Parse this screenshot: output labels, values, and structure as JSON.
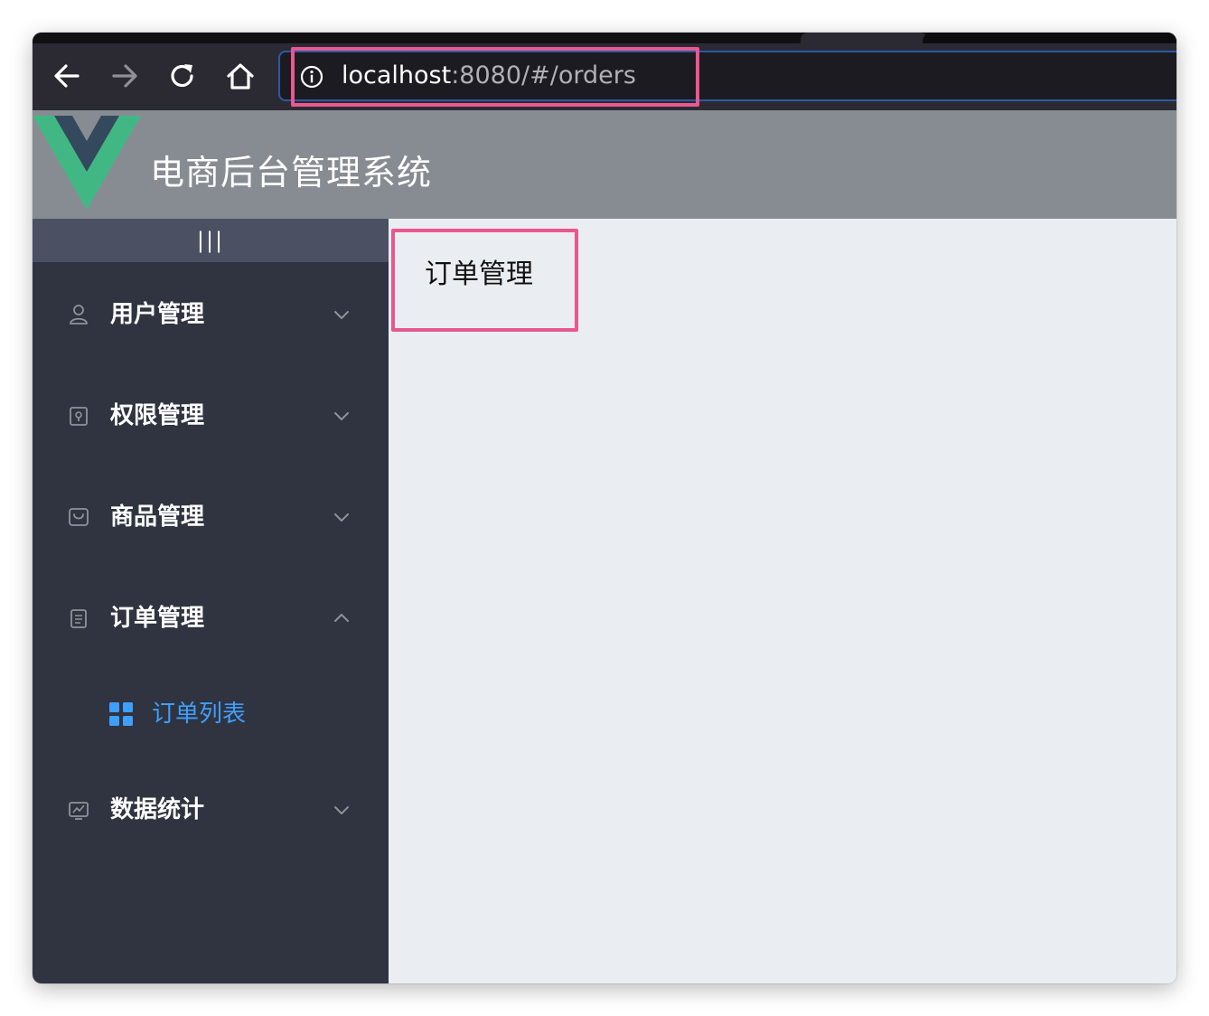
{
  "browser": {
    "url_host": "localhost",
    "url_rest": ":8080/#/orders"
  },
  "app": {
    "title": "电商后台管理系统"
  },
  "sidebar": {
    "collapse_label": "|||",
    "items": [
      {
        "label": "用户管理",
        "icon": "user-icon",
        "expanded": false
      },
      {
        "label": "权限管理",
        "icon": "lock-icon",
        "expanded": false
      },
      {
        "label": "商品管理",
        "icon": "goods-icon",
        "expanded": false
      },
      {
        "label": "订单管理",
        "icon": "order-icon",
        "expanded": true
      },
      {
        "label": "数据统计",
        "icon": "chart-icon",
        "expanded": false
      }
    ],
    "sub_items": [
      {
        "label": "订单列表",
        "icon": "menu-grid-icon",
        "active": true
      }
    ]
  },
  "main": {
    "heading": "订单管理"
  },
  "colors": {
    "highlight": "#e8588f",
    "active_submenu": "#409eff",
    "sidebar_bg": "#2f3440",
    "header_bg": "#878c93",
    "vue_green": "#41b883",
    "vue_navy": "#34495e"
  }
}
